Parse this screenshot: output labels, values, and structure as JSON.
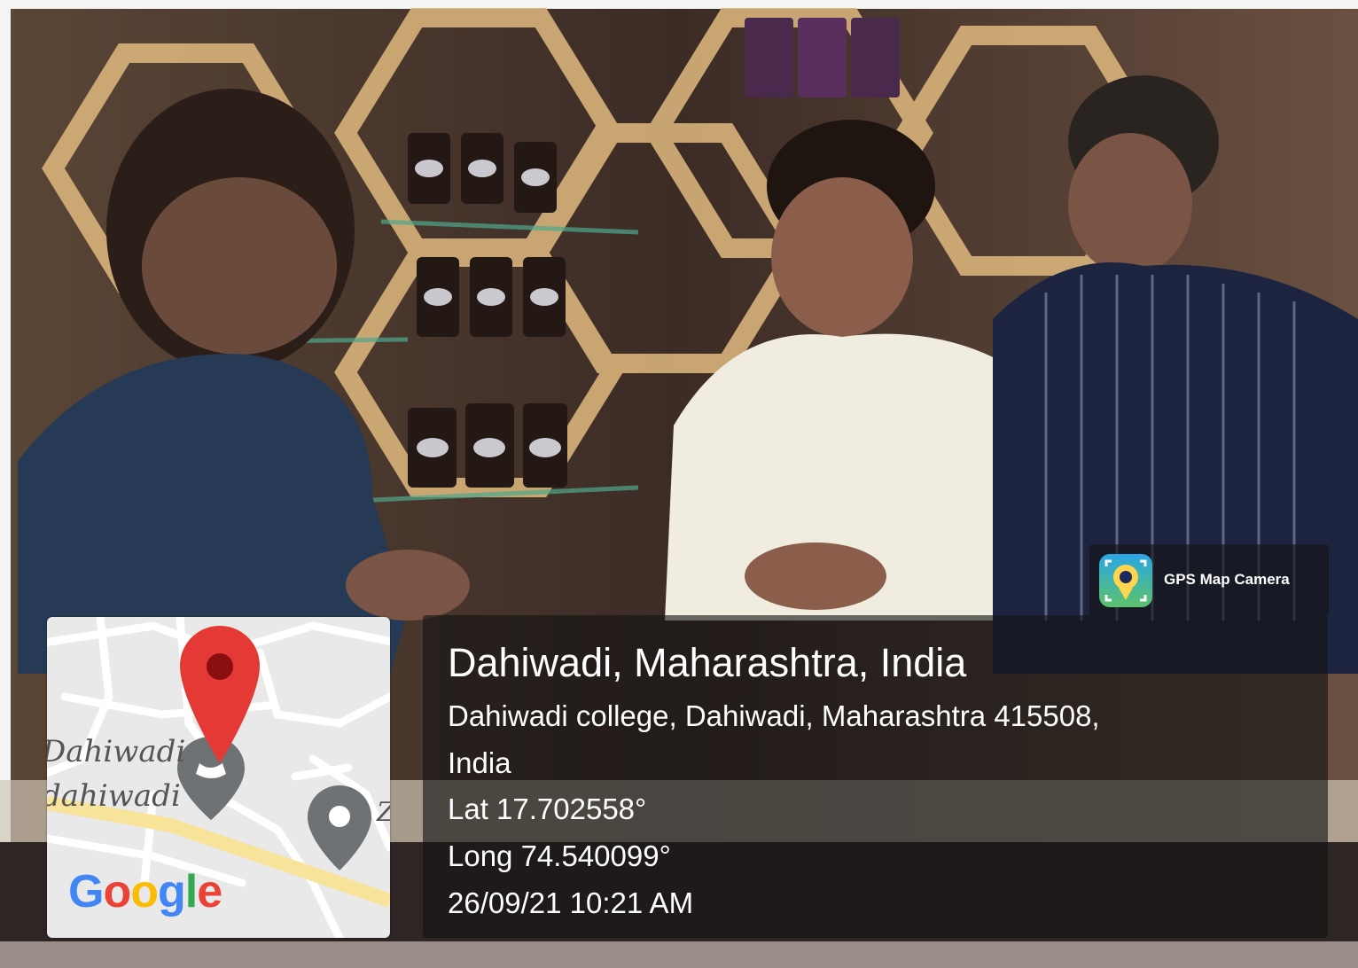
{
  "app_badge": {
    "name": "GPS Map Camera",
    "icon": "gps-map-camera-icon"
  },
  "map": {
    "labels": [
      "Dahiwadi",
      "dahiwadi"
    ],
    "logo": "Google",
    "pins": [
      "red-location-pin-icon",
      "grey-location-pin-icon"
    ]
  },
  "location": {
    "title": "Dahiwadi, Maharashtra, India",
    "address_line1": "Dahiwadi college, Dahiwadi, Maharashtra 415508,",
    "address_line2": "India",
    "latitude": "Lat 17.702558°",
    "longitude": "Long 74.540099°",
    "datetime": "26/09/21 10:21 AM"
  },
  "colors": {
    "pin_red": "#E53935",
    "panel_bg": "rgba(20,20,20,0.62)"
  }
}
